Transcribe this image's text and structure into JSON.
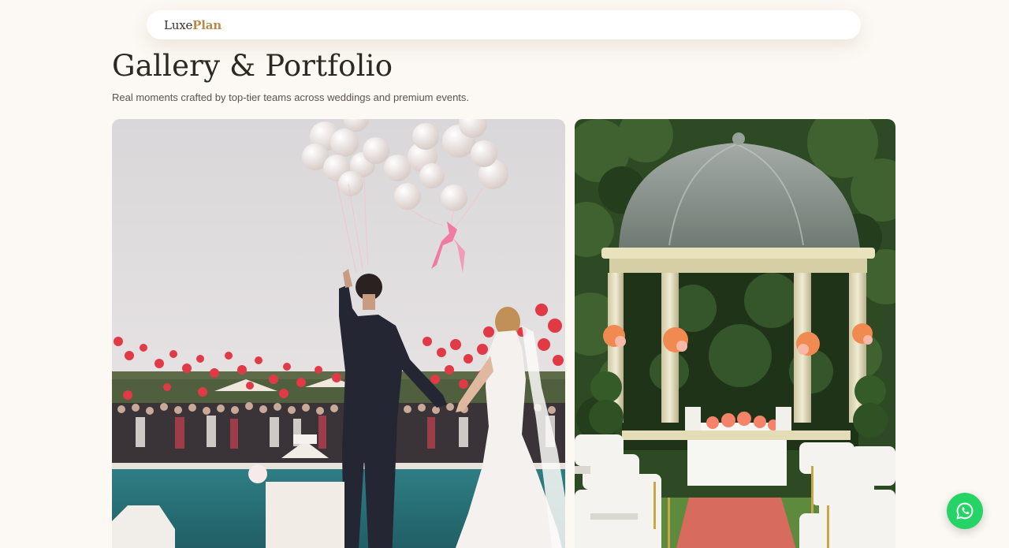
{
  "navbar": {
    "logo_part1": "Luxe",
    "logo_part2": "Plan"
  },
  "header": {
    "title": "Gallery & Portfolio",
    "subtitle": "Real moments crafted by top-tier teams across weddings and premium events."
  },
  "gallery": {
    "items": [
      {
        "icon": "wedding-couple-balloons-photo"
      },
      {
        "icon": "garden-gazebo-ceremony-photo"
      }
    ]
  },
  "floating": {
    "whatsapp_icon": "whatsapp-icon",
    "color": "#25d366"
  },
  "colors": {
    "background": "#fcf8f3",
    "accent": "#b88a4a",
    "text": "#2e2822"
  }
}
